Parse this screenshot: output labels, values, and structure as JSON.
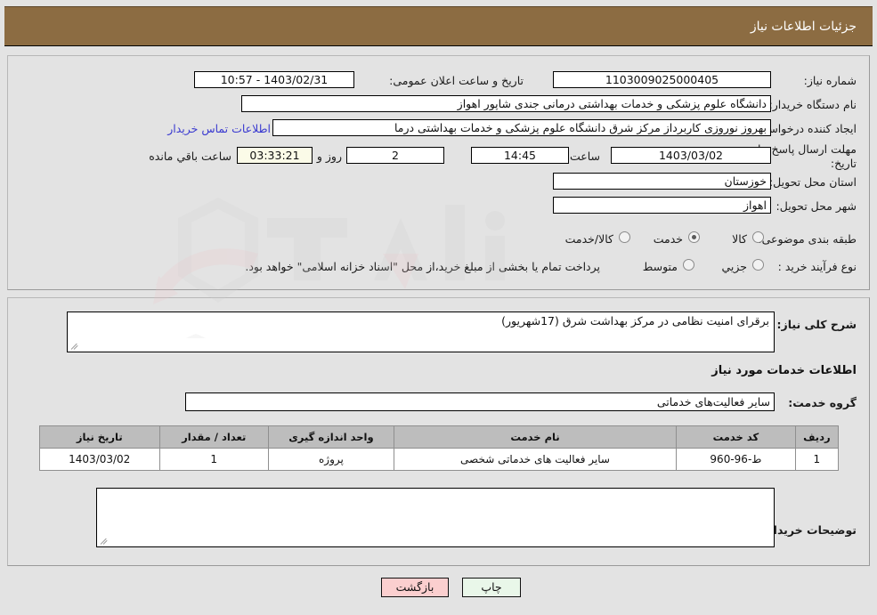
{
  "header": {
    "title": "جزئیات اطلاعات نیاز"
  },
  "top_section": {
    "need_number_label": "شماره نیاز:",
    "need_number_value": "1103009025000405",
    "announce_label": "تاریخ و ساعت اعلان عمومی:",
    "announce_value": "1403/02/31 - 10:57",
    "buyer_org_label": "نام دستگاه خریدار:",
    "buyer_org_value": "دانشگاه علوم پزشکی و خدمات بهداشتی درمانی جندی شاپور اهواز",
    "creator_label": "ایجاد کننده درخواست:",
    "creator_value": "اطلاعات تماس خریدار",
    "creator_extra": "بهروز نوروزی کاربرداز مرکز شرق دانشگاه علوم پزشکی و خدمات بهداشتی درما",
    "contact_link": "اطلاعات تماس خریدار",
    "deadline_label_line1": "مهلت ارسال پاسخ: تا",
    "deadline_label_line2": "تاریخ:",
    "deadline_date": "1403/03/02",
    "deadline_hour_label": "ساعت",
    "deadline_hour": "14:45",
    "days_value": "2",
    "days_label": "روز و",
    "timer_value": "03:33:21",
    "timer_label": "ساعت باقي مانده",
    "province_label": "استان محل تحویل:",
    "province_value": "خوزستان",
    "city_label": "شهر محل تحویل:",
    "city_value": "اهواز",
    "category_label": "طبقه بندی موضوعی:",
    "category_options": [
      {
        "label": "کالا",
        "selected": false
      },
      {
        "label": "خدمت",
        "selected": true
      },
      {
        "label": "کالا/خدمت",
        "selected": false
      }
    ],
    "process_label": "نوع فرآیند خرید :",
    "process_options": [
      {
        "label": "جزیي",
        "selected": false
      },
      {
        "label": "متوسط",
        "selected": false
      }
    ],
    "treasury_note": "پرداخت تمام یا بخشی از مبلغ خرید،از محل \"اسناد خزانه اسلامی\" خواهد بود."
  },
  "bottom_section": {
    "need_desc_label": "شرح کلی نیاز:",
    "need_desc_value": "برقرای امنیت نظامی در مرکز بهداشت شرق (17شهریور)",
    "services_heading": "اطلاعات خدمات مورد نیاز",
    "service_group_label": "گروه خدمت:",
    "service_group_value": "سایر فعالیت‌های خدماتی",
    "table": {
      "headers": [
        "ردیف",
        "کد خدمت",
        "نام خدمت",
        "واحد اندازه گیری",
        "تعداد / مقدار",
        "تاریخ نیاز"
      ],
      "rows": [
        {
          "radif": "1",
          "code": "ط-96-960",
          "name": "سایر فعالیت های خدماتی شخصی",
          "unit": "پروژه",
          "qty": "1",
          "date": "1403/03/02"
        }
      ]
    },
    "buyer_notes_label": "توضیحات خریدار:",
    "buyer_notes_value": ""
  },
  "footer": {
    "print_label": "چاپ",
    "back_label": "بازگشت"
  },
  "colors": {
    "header_bg": "#8c6c42",
    "page_bg": "#e3e3e3",
    "link": "#3a3ad0",
    "timer_bg": "#fbfbe8",
    "print_btn_bg": "#e9f7e9",
    "back_btn_bg": "#fbcfcf"
  },
  "watermark": {
    "text": "AnaTender.net"
  }
}
